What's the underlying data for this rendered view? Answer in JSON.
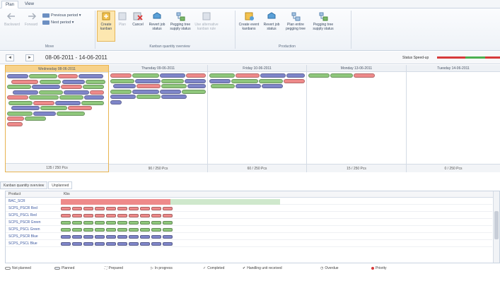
{
  "tabs": [
    "Plan",
    "View"
  ],
  "ribbon": {
    "move": {
      "backward": "Backward",
      "forward": "Forward",
      "previous_period": "Previous period",
      "next_period": "Next period",
      "group": "Move"
    },
    "kanban_overview": {
      "create_kanban": "Create kanban",
      "plan": "Plan",
      "cancel": "Cancel",
      "revert_job_status": "Revert job status",
      "pegging_tree_supply_status": "Pegging tree supply status",
      "use_alternative_kanban_rule": "Use alternative kanban rule",
      "group": "Kanban quantity overview"
    },
    "production": {
      "create_event_kanbans": "Create event kanbans",
      "revert_job_status": "Revert job status",
      "plan_entire_pegging_tree": "Plan entire pegging tree",
      "pegging_tree_supply_status": "Pegging tree supply status",
      "group": "Production"
    }
  },
  "datebar": {
    "back": "◄",
    "forward": "►",
    "range": "08-06-2011 - 14-06-2011",
    "status_label": "Status Speed-up",
    "status_colors": [
      "#d63a3a",
      "#d63a3a",
      "#4caf50",
      "#4caf50",
      "#d63a3a"
    ]
  },
  "days": [
    {
      "label": "Wednesday 08-06-2011",
      "total": "135 / 250 Pcs",
      "selected": true
    },
    {
      "label": "Thursday 09-06-2011",
      "total": "90 / 250 Pcs",
      "selected": false
    },
    {
      "label": "Friday 10-06-2011",
      "total": "60 / 250 Pcs",
      "selected": false
    },
    {
      "label": "Monday 13-06-2011",
      "total": "15 / 250 Pcs",
      "selected": false
    },
    {
      "label": "Tuesday 14-06-2011",
      "total": "0 / 250 Pcs",
      "selected": false
    }
  ],
  "bottom_tabs": [
    "Kanban quantity overview",
    "Unplanned"
  ],
  "grid": {
    "columns": [
      "Product",
      "Kbs"
    ],
    "rows": [
      {
        "product": "BAC_SCR"
      },
      {
        "product": "SCPS_PSCR Red"
      },
      {
        "product": "SCPS_PSCL Red"
      },
      {
        "product": "SCPS_PSCR Green"
      },
      {
        "product": "SCPS_PSCL Green"
      },
      {
        "product": "SCPS_PSCR Blue"
      },
      {
        "product": "SCPS_PSCL Blue"
      }
    ]
  },
  "legend": [
    {
      "label": "Not planned",
      "icon": "not-planned-icon"
    },
    {
      "label": "Planned",
      "icon": "planned-icon"
    },
    {
      "label": "Prepared",
      "icon": "prepared-icon"
    },
    {
      "label": "In progress",
      "icon": "in-progress-icon"
    },
    {
      "label": "Completed",
      "icon": "completed-icon"
    },
    {
      "label": "Handling unit received",
      "icon": "handling-unit-icon"
    },
    {
      "label": "Overdue",
      "icon": "overdue-icon"
    },
    {
      "label": "Priority",
      "icon": "priority-icon"
    }
  ],
  "colors": {
    "purple": "#7f86c9",
    "green": "#8fc77c",
    "red": "#ee8a8a",
    "selected_day": "#f7d28a"
  }
}
